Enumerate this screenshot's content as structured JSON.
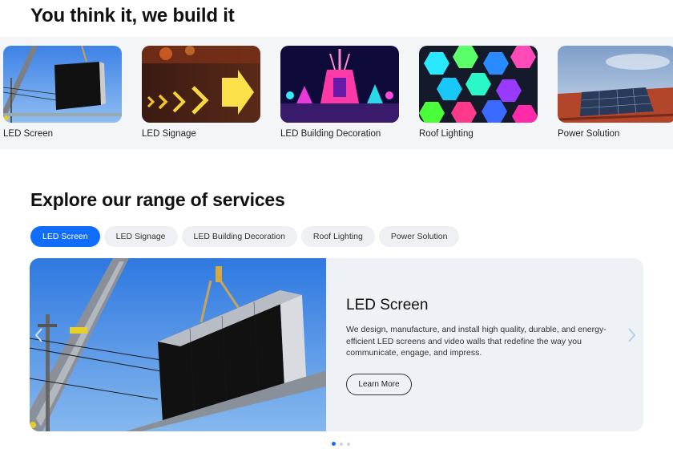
{
  "hero": {
    "title": "You think it, we build it"
  },
  "products": [
    {
      "label": "LED Screen"
    },
    {
      "label": "LED Signage"
    },
    {
      "label": "LED Building Decoration"
    },
    {
      "label": "Roof Lighting"
    },
    {
      "label": "Power Solution"
    }
  ],
  "services": {
    "title": "Explore our range of services",
    "tabs": [
      {
        "label": "LED Screen",
        "active": true
      },
      {
        "label": "LED Signage",
        "active": false
      },
      {
        "label": "LED Building Decoration",
        "active": false
      },
      {
        "label": "Roof Lighting",
        "active": false
      },
      {
        "label": "Power Solution",
        "active": false
      }
    ],
    "panel": {
      "title": "LED Screen",
      "description": "We design, manufacture, and install high quality, durable, and energy-efficient LED screens and video walls that redefine the way you communicate, engage, and impress.",
      "button_label": "Learn More"
    },
    "pagination": {
      "count": 3,
      "active_index": 0
    }
  },
  "colors": {
    "accent": "#116dff",
    "strip_bg": "#f4f5f7",
    "panel_bg": "#eef1f6"
  },
  "icons": {
    "prev": "chevron-left-icon",
    "next": "chevron-right-icon"
  }
}
